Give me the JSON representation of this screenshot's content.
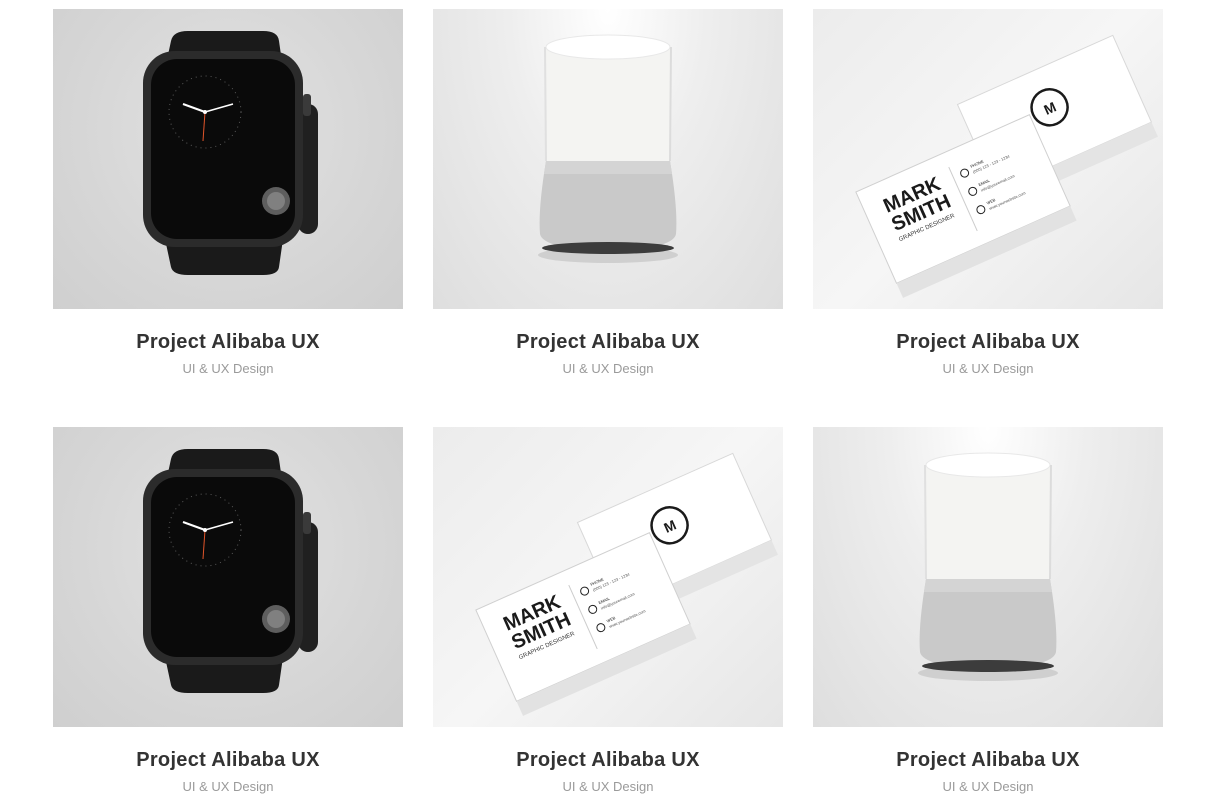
{
  "portfolio": {
    "items": [
      {
        "title": "Project Alibaba UX",
        "category": "UI & UX Design",
        "image": "smartwatch"
      },
      {
        "title": "Project Alibaba UX",
        "category": "UI & UX Design",
        "image": "smart-speaker"
      },
      {
        "title": "Project Alibaba UX",
        "category": "UI & UX Design",
        "image": "business-cards"
      },
      {
        "title": "Project Alibaba UX",
        "category": "UI & UX Design",
        "image": "smartwatch"
      },
      {
        "title": "Project Alibaba UX",
        "category": "UI & UX Design",
        "image": "business-cards"
      },
      {
        "title": "Project Alibaba UX",
        "category": "UI & UX Design",
        "image": "smart-speaker"
      }
    ],
    "business_card": {
      "monogram": "M",
      "name_line1": "MARK",
      "name_line2": "SMITH",
      "role": "GRAPHIC DESIGNER",
      "phone_label": "PHONE",
      "phone": "(000) 123 - 123 - 1234",
      "email_label": "EMAIL",
      "email": "info@youremail.com",
      "web_label": "WEB",
      "web": "www.yourwebsite.com"
    },
    "colors": {
      "title": "#333333",
      "subtitle": "#9a9a9a",
      "background": "#ffffff"
    }
  }
}
